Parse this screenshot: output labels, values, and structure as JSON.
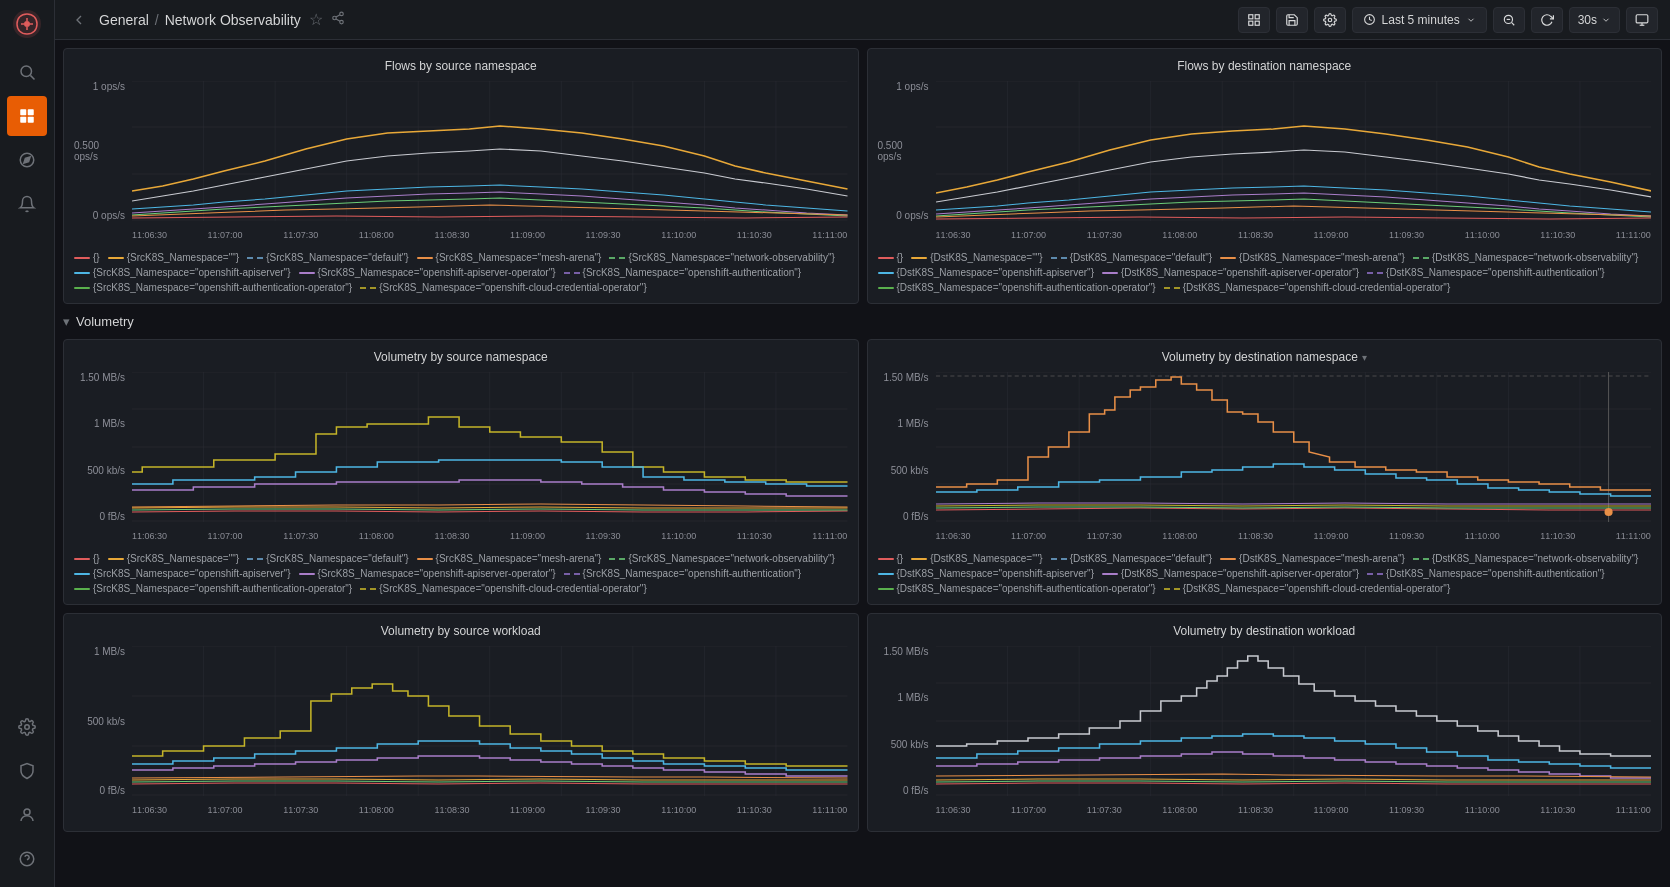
{
  "app": {
    "breadcrumb_root": "General",
    "breadcrumb_sep": "/",
    "breadcrumb_title": "Network Observability"
  },
  "topbar": {
    "toggle_label": "◂",
    "add_panel": "📊",
    "save": "💾",
    "settings": "⚙",
    "time_range": "Last 5 minutes",
    "zoom_out": "🔍",
    "refresh": "↻",
    "refresh_interval": "30s",
    "tv_mode": "⬜"
  },
  "sections": {
    "volumetry_label": "Volumetry"
  },
  "panels": {
    "flows_src": {
      "title": "Flows by source namespace",
      "y_labels": [
        "1 ops/s",
        "0.500 ops/s",
        "0 ops/s"
      ],
      "x_labels": [
        "11:06:30",
        "11:07:00",
        "11:07:30",
        "11:08:00",
        "11:08:30",
        "11:09:00",
        "11:09:30",
        "11:10:00",
        "11:10:30",
        "11:11:00"
      ]
    },
    "flows_dst": {
      "title": "Flows by destination namespace",
      "y_labels": [
        "1 ops/s",
        "0.500 ops/s",
        "0 ops/s"
      ],
      "x_labels": [
        "11:06:30",
        "11:07:00",
        "11:07:30",
        "11:08:00",
        "11:08:30",
        "11:09:00",
        "11:09:30",
        "11:10:00",
        "11:10:30",
        "11:11:00"
      ]
    },
    "vol_src": {
      "title": "Volumetry by source namespace",
      "y_labels": [
        "1.50 MB/s",
        "1 MB/s",
        "500 kb/s",
        "0 fB/s"
      ],
      "x_labels": [
        "11:06:30",
        "11:07:00",
        "11:07:30",
        "11:08:00",
        "11:08:30",
        "11:09:00",
        "11:09:30",
        "11:10:00",
        "11:10:30",
        "11:11:00"
      ]
    },
    "vol_dst": {
      "title": "Volumetry by destination namespace",
      "y_labels": [
        "1.50 MB/s",
        "1 MB/s",
        "500 kb/s",
        "0 fB/s"
      ],
      "x_labels": [
        "11:06:30",
        "11:07:00",
        "11:07:30",
        "11:08:00",
        "11:08:30",
        "11:09:00",
        "11:09:30",
        "11:10:00",
        "11:10:30",
        "11:11:00"
      ]
    },
    "vol_src_wl": {
      "title": "Volumetry by source workload",
      "y_labels": [
        "1 MB/s",
        "500 kb/s",
        "0 fB/s"
      ],
      "x_labels": [
        "11:06:30",
        "11:07:00",
        "11:07:30",
        "11:08:00",
        "11:08:30",
        "11:09:00",
        "11:09:30",
        "11:10:00",
        "11:10:30",
        "11:11:00"
      ]
    },
    "vol_dst_wl": {
      "title": "Volumetry by destination workload",
      "y_labels": [
        "1.50 MB/s",
        "1 MB/s",
        "500 kb/s",
        "0 fB/s"
      ],
      "x_labels": [
        "11:06:30",
        "11:07:00",
        "11:07:30",
        "11:08:00",
        "11:08:30",
        "11:09:00",
        "11:09:30",
        "11:10:00",
        "11:10:30",
        "11:11:00"
      ]
    }
  },
  "legend_items": {
    "src": [
      {
        "label": "{}",
        "color": "#e05c5c",
        "dash": false
      },
      {
        "label": "{SrcK8S_Namespace=\"\"}",
        "color": "#e8a838",
        "dash": true
      },
      {
        "label": "{SrcK8S_Namespace=\"default\"}",
        "color": "#6ea6d0",
        "dash": true
      },
      {
        "label": "{SrcK8S_Namespace=\"mesh-arena\"}",
        "color": "#e88f47",
        "dash": false
      },
      {
        "label": "{SrcK8S_Namespace=\"network-observability\"}",
        "color": "#6bcb77",
        "dash": true
      },
      {
        "label": "{SrcK8S_Namespace=\"openshift-apiserver\"}",
        "color": "#4db6e4",
        "dash": false
      },
      {
        "label": "{SrcK8S_Namespace=\"openshift-apiserver-operator\"}",
        "color": "#a97dc9",
        "dash": false
      },
      {
        "label": "{SrcK8S_Namespace=\"openshift-authentication\"}",
        "color": "#9070c8",
        "dash": true
      },
      {
        "label": "{SrcK8S_Namespace=\"openshift-authentication-operator\"}",
        "color": "#5ab04d",
        "dash": false
      },
      {
        "label": "{SrcK8S_Namespace=\"openshift-cloud-credential-operator\"}",
        "color": "#c4b428",
        "dash": true
      }
    ],
    "dst": [
      {
        "label": "{}",
        "color": "#e05c5c",
        "dash": false
      },
      {
        "label": "{DstK8S_Namespace=\"\"}",
        "color": "#e8a838",
        "dash": true
      },
      {
        "label": "{DstK8S_Namespace=\"default\"}",
        "color": "#6ea6d0",
        "dash": true
      },
      {
        "label": "{DstK8S_Namespace=\"mesh-arena\"}",
        "color": "#e88f47",
        "dash": false
      },
      {
        "label": "{DstK8S_Namespace=\"network-observability\"}",
        "color": "#6bcb77",
        "dash": true
      },
      {
        "label": "{DstK8S_Namespace=\"openshift-apiserver\"}",
        "color": "#4db6e4",
        "dash": false
      },
      {
        "label": "{DstK8S_Namespace=\"openshift-apiserver-operator\"}",
        "color": "#a97dc9",
        "dash": false
      },
      {
        "label": "{DstK8S_Namespace=\"openshift-authentication\"}",
        "color": "#9070c8",
        "dash": true
      },
      {
        "label": "{DstK8S_Namespace=\"openshift-authentication-operator\"}",
        "color": "#5ab04d",
        "dash": false
      },
      {
        "label": "{DstK8S_Namespace=\"openshift-cloud-credential-operator\"}",
        "color": "#c4b428",
        "dash": true
      }
    ]
  }
}
